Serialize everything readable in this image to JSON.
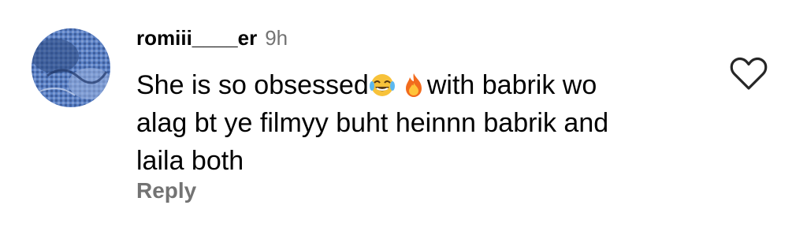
{
  "comment": {
    "username": "romiii____er",
    "timestamp": "9h",
    "text_before_emoji": "She is so obsessed",
    "emojis": [
      "face-with-tears-of-joy",
      "fire"
    ],
    "text_after_emoji": "with babrik wo\nalag bt ye filmyy buht heinnn babrik and\nlaila both",
    "reply_label": "Reply",
    "like_icon": "heart-outline-icon"
  },
  "colors": {
    "text": "#000000",
    "secondary_text": "#737373",
    "background": "#ffffff"
  }
}
